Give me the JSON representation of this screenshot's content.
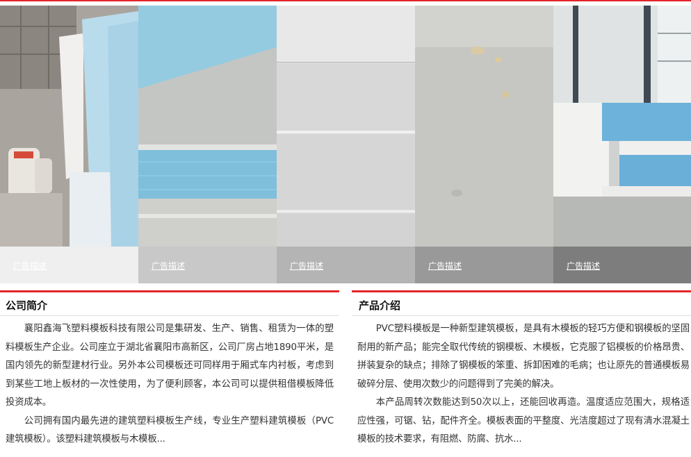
{
  "gallery": {
    "items": [
      {
        "caption": "广告描述"
      },
      {
        "caption": "广告描述"
      },
      {
        "caption": "广告描述"
      },
      {
        "caption": "广告描述"
      },
      {
        "caption": "广告描述"
      }
    ]
  },
  "company": {
    "title": "公司简介",
    "paragraphs": [
      "襄阳鑫海飞塑料模板科技有限公司是集研发、生产、销售、租赁为一体的塑料模板生产企业。公司座立于湖北省襄阳市高新区，公司厂房占地1890平米，是国内领先的新型建材行业。另外本公司模板还可同样用于厢式车内衬板，考虑到到某些工地上板材的一次性使用，为了便利顾客，本公司可以提供租借模板降低投资成本。",
      "公司拥有国内最先进的建筑塑料模板生产线，专业生产塑料建筑模板（PVC建筑模板）。该塑料建筑模板与木模板..."
    ]
  },
  "product": {
    "title": "产品介绍",
    "paragraphs": [
      "PVC塑料模板是一种新型建筑模板，是具有木模板的轻巧方便和钢模板的坚固耐用的新产品；能完全取代传统的钢模板、木模板，它克服了铝模板的价格昂贵、拼装复杂的缺点；排除了钢模板的笨重、拆卸困难的毛病；也让原先的普通模板易破碎分层、使用次数少的问题得到了完美的解决。",
      "本产品周转次数能达到50次以上，还能回收再造。温度适应范围大，规格适应性强，可锯、钻，配件齐全。模板表面的平整度、光洁度超过了现有清水混凝土模板的技术要求，有阻燃、防腐、抗水..."
    ]
  }
}
